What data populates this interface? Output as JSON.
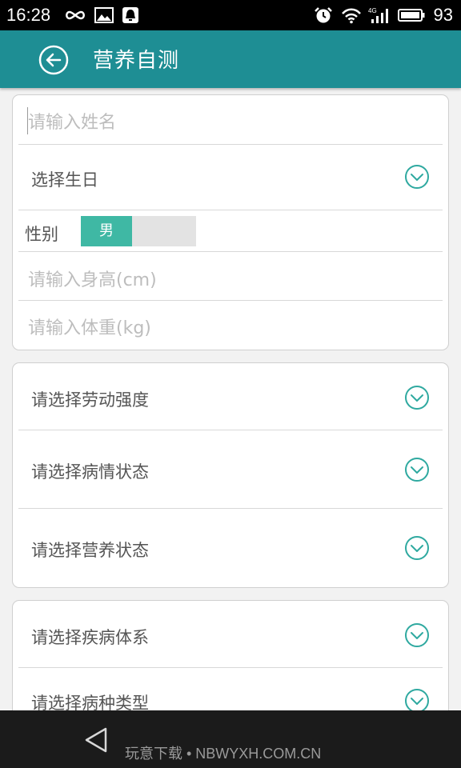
{
  "status_bar": {
    "time": "16:28",
    "battery_percent": "93",
    "icons": [
      "infinity-icon",
      "image-icon",
      "notification-icon",
      "alarm-icon",
      "wifi-icon",
      "signal-4g-icon",
      "battery-icon"
    ]
  },
  "header": {
    "title": "营养自测",
    "back_icon": "back-arrow-icon",
    "background": "#1e8e94"
  },
  "card1": {
    "name_placeholder": "请输入姓名",
    "birthday_label": "选择生日",
    "gender_label": "性别",
    "gender_selected": "男",
    "height_placeholder": "请输入身高(cm)",
    "weight_placeholder": "请输入体重(kg)"
  },
  "card2": {
    "items": [
      "请选择劳动强度",
      "请选择病情状态",
      "请选择营养状态"
    ]
  },
  "card3": {
    "items": [
      "请选择疾病体系",
      "请选择病种类型"
    ]
  },
  "nav_bar": {
    "watermark": "玩意下载 • NBWYXH.COM.CN"
  },
  "colors": {
    "accent": "#3fb8a4",
    "chevron": "#2fa9a0"
  }
}
